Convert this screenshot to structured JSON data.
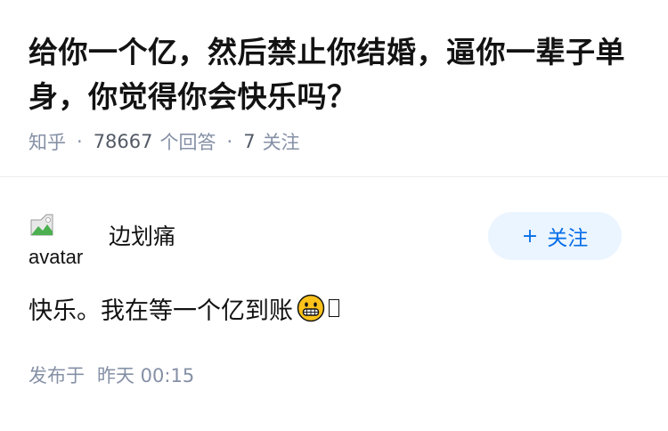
{
  "question": {
    "title": "给你一个亿，然后禁止你结婚，逼你一辈子单身，你觉得你会快乐吗？",
    "source": "知乎",
    "separator": "·",
    "answer_count": "78667",
    "answer_label": "个回答",
    "follow_count": "7",
    "follow_label": "关注"
  },
  "answer": {
    "avatar_alt": "avatar",
    "author_name": "边划痛",
    "follow_button": {
      "plus": "+",
      "label": "关注"
    },
    "content": "快乐。我在等一个亿到账",
    "emoji_icon": "grinning-face-icon",
    "published_label": "发布于",
    "published_time": "昨天 00:15"
  },
  "colors": {
    "accent": "#056de8",
    "button_bg": "#ebf5ff",
    "meta_text": "#8590a6",
    "title_text": "#121212"
  }
}
